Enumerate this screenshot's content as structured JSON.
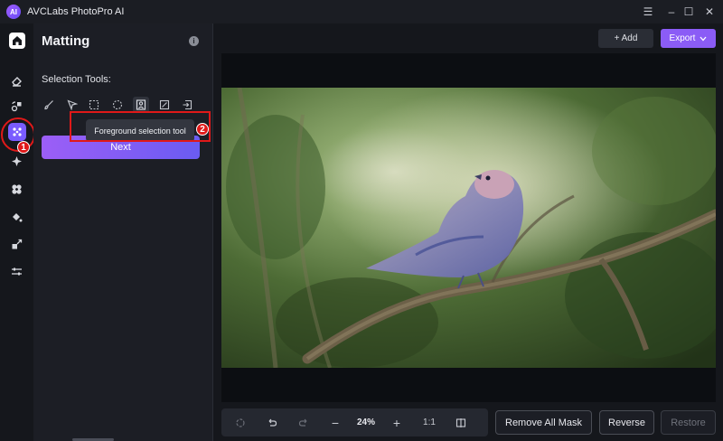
{
  "window": {
    "title": "AVCLabs PhotoPro AI",
    "logo_text": "AI",
    "controls": [
      "☰",
      "–",
      "☐",
      "✕"
    ]
  },
  "rail": {
    "items": [
      "home",
      "eraser",
      "replace",
      "matting",
      "enhance",
      "colorize",
      "fill",
      "crop",
      "adjust"
    ]
  },
  "panel": {
    "title": "Matting",
    "info": "i",
    "selection_label": "Selection Tools:",
    "tools": [
      "brush",
      "pointer",
      "rect-select",
      "lasso",
      "foreground-select",
      "subject-select",
      "import"
    ],
    "next_label": "Next",
    "tooltip": "Foreground selection tool"
  },
  "annotations": {
    "badge1": "1",
    "badge2": "2",
    "color": "#e01919"
  },
  "toolbar": {
    "add_label": "+ Add",
    "export_label": "Export",
    "export_color": "#8b5cf6"
  },
  "bottom": {
    "zoom_minus": "−",
    "zoom": "24%",
    "zoom_plus": "+",
    "ratio": "1:1",
    "remove_all": "Remove All Mask",
    "reverse": "Reverse",
    "restore": "Restore"
  }
}
